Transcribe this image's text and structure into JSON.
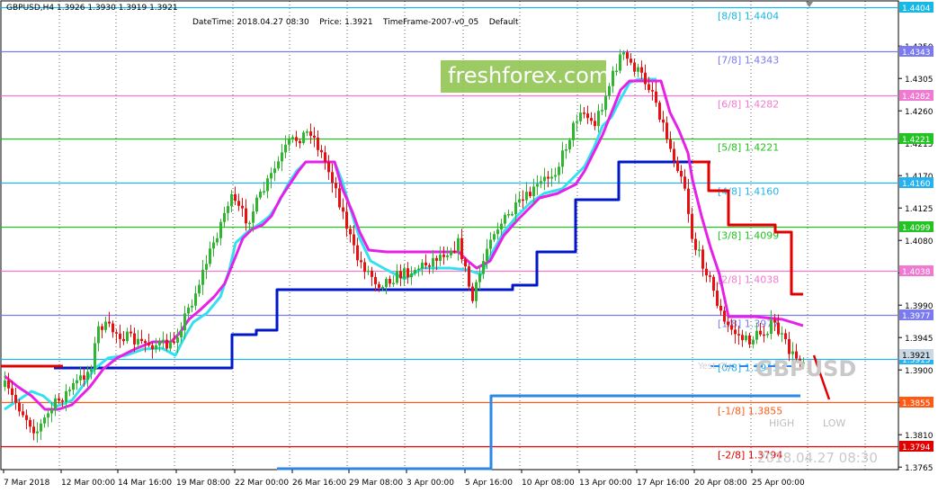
{
  "symbol_header": "GBPUSD,H4  1.3926 1.3930 1.3919 1.3921",
  "info": {
    "datetime": "DateTime: 2018.04.27 08:30",
    "price": "Price: 1.3921",
    "timeframe": "TimeFrame-2007-v0_05",
    "default": "Default"
  },
  "watermark": "freshforex.com",
  "symbol_watermark": "GBPUSD",
  "date_watermark": "2018.04.27 08:30",
  "high_label": "HIGH",
  "low_label": "LOW",
  "yesterday_label": "Yest Cls",
  "colors": {
    "bull": "#2fb52f",
    "bear": "#e81010",
    "cyan_line": "#33e0ef",
    "magenta_line": "#e620e6",
    "blue_line": "#0018c8",
    "red_line": "#e00000",
    "light_blue_line": "#2e86e6"
  },
  "price_axis": {
    "ticks": [
      "1.4350",
      "1.4305",
      "1.4260",
      "1.4215",
      "1.4170",
      "1.4125",
      "1.4080",
      "1.4035",
      "1.3990",
      "1.3945",
      "1.3900",
      "1.3855",
      "1.3810",
      "1.3765"
    ]
  },
  "time_axis": {
    "labels": [
      "7 Mar 2018",
      "12 Mar 00:00",
      "14 Mar 16:00",
      "19 Mar 08:00",
      "22 Mar 00:00",
      "26 Mar 16:00",
      "29 Mar 08:00",
      "3 Apr 00:00",
      "5 Apr 16:00",
      "10 Apr 08:00",
      "13 Apr 00:00",
      "17 Apr 16:00",
      "20 Apr 08:00",
      "25 Apr 00:00"
    ]
  },
  "murrey_levels": [
    {
      "label": "[8/8]",
      "value": "1.4404",
      "color": "#17b7e6",
      "badge_bg": "#17b7e6",
      "badge": "1.4404"
    },
    {
      "label": "[7/8]",
      "value": "1.4343",
      "color": "#7b7bf0",
      "badge_bg": "#7b7bf0",
      "badge": "1.4343"
    },
    {
      "label": "[6/8]",
      "value": "1.4282",
      "color": "#f07ad2",
      "badge_bg": "#f07ad2",
      "badge": "1.4282"
    },
    {
      "label": "[5/8]",
      "value": "1.4221",
      "color": "#22c322",
      "badge_bg": "#22c322",
      "badge": "1.4221"
    },
    {
      "label": "[4/8]",
      "value": "1.4160",
      "color": "#25b2ee",
      "badge_bg": "#25b2ee",
      "badge": "1.4160"
    },
    {
      "label": "[3/8]",
      "value": "1.4099",
      "color": "#22c322",
      "badge_bg": "#22c322",
      "badge": "1.4099"
    },
    {
      "label": "[2/8]",
      "value": "1.4038",
      "color": "#f07ad2",
      "badge_bg": "#f07ad2",
      "badge": "1.4038"
    },
    {
      "label": "[1/8]",
      "value": "1.3977",
      "color": "#7b7bf0",
      "badge_bg": "#7b7bf0",
      "badge": "1.3977"
    },
    {
      "label": "[0/8]",
      "value": "1.3915",
      "color": "#25b2ee",
      "badge_bg": "#25b2ee",
      "badge": "1.3915"
    },
    {
      "label": "[-1/8]",
      "value": "1.3855",
      "color": "#ff5a14",
      "badge_bg": "#ff5a14",
      "badge": "1.3855"
    },
    {
      "label": "[-2/8]",
      "value": "1.3794",
      "color": "#e00000",
      "badge_bg": "#e00000",
      "badge": "1.3794"
    }
  ],
  "current_price_badge": "1.3921"
}
